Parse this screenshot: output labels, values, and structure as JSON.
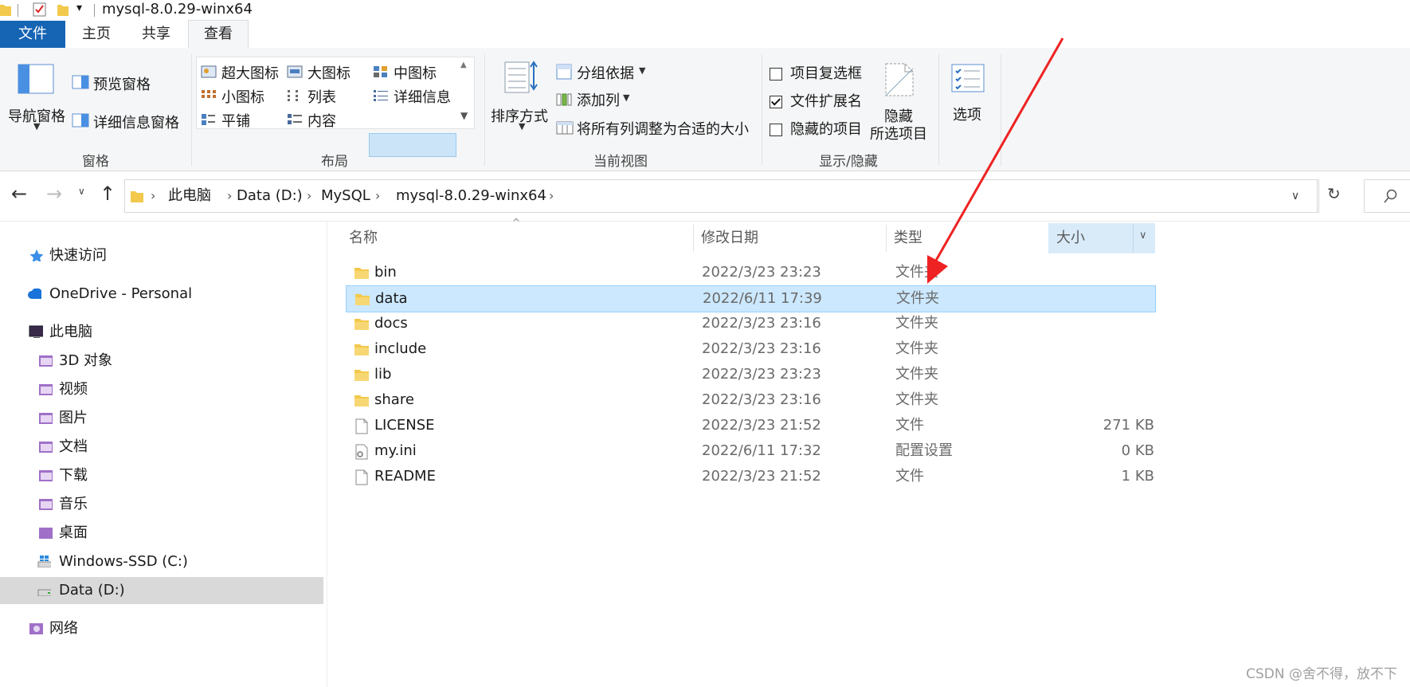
{
  "window": {
    "title": "mysql-8.0.29-winx64"
  },
  "tabs": [
    "文件",
    "主页",
    "共享",
    "查看"
  ],
  "ribbon": {
    "pane": {
      "nav_pane": "导航窗格",
      "preview_pane": "预览窗格",
      "details_pane": "详细信息窗格",
      "label": "窗格"
    },
    "layout": {
      "items": [
        "超大图标",
        "大图标",
        "中图标",
        "小图标",
        "列表",
        "详细信息",
        "平铺",
        "内容"
      ],
      "label": "布局"
    },
    "current_view": {
      "sort": "排序方式",
      "group_by": "分组依据",
      "add_column": "添加列",
      "fit_columns": "将所有列调整为合适的大小",
      "label": "当前视图"
    },
    "show_hide": {
      "checkboxes": [
        {
          "label": "项目复选框",
          "checked": false
        },
        {
          "label": "文件扩展名",
          "checked": true
        },
        {
          "label": "隐藏的项目",
          "checked": false
        }
      ],
      "hide_selected_1": "隐藏",
      "hide_selected_2": "所选项目",
      "label": "显示/隐藏"
    },
    "options": "选项"
  },
  "address": {
    "crumbs": [
      "此电脑",
      "Data (D:)",
      "MySQL",
      "mysql-8.0.29-winx64"
    ]
  },
  "nav": {
    "quick_access": "快速访问",
    "onedrive": "OneDrive - Personal",
    "this_pc": "此电脑",
    "folders": [
      "3D 对象",
      "视频",
      "图片",
      "文档",
      "下载",
      "音乐",
      "桌面",
      "Windows-SSD (C:)",
      "Data (D:)"
    ],
    "network": "网络"
  },
  "columns": {
    "name": "名称",
    "date": "修改日期",
    "type": "类型",
    "size": "大小"
  },
  "files": [
    {
      "name": "bin",
      "date": "2022/3/23 23:23",
      "type": "文件夹",
      "size": "",
      "kind": "folder"
    },
    {
      "name": "data",
      "date": "2022/6/11 17:39",
      "type": "文件夹",
      "size": "",
      "kind": "folder",
      "selected": true
    },
    {
      "name": "docs",
      "date": "2022/3/23 23:16",
      "type": "文件夹",
      "size": "",
      "kind": "folder"
    },
    {
      "name": "include",
      "date": "2022/3/23 23:16",
      "type": "文件夹",
      "size": "",
      "kind": "folder"
    },
    {
      "name": "lib",
      "date": "2022/3/23 23:23",
      "type": "文件夹",
      "size": "",
      "kind": "folder"
    },
    {
      "name": "share",
      "date": "2022/3/23 23:16",
      "type": "文件夹",
      "size": "",
      "kind": "folder"
    },
    {
      "name": "LICENSE",
      "date": "2022/3/23 21:52",
      "type": "文件",
      "size": "271 KB",
      "kind": "file"
    },
    {
      "name": "my.ini",
      "date": "2022/6/11 17:32",
      "type": "配置设置",
      "size": "0 KB",
      "kind": "ini"
    },
    {
      "name": "README",
      "date": "2022/3/23 21:52",
      "type": "文件",
      "size": "1 KB",
      "kind": "file"
    }
  ],
  "watermark": "CSDN @舍不得，放不下",
  "colors": {
    "accent": "#1664b4",
    "selection": "#cce8ff",
    "annotation_arrow": "#ee2222"
  }
}
